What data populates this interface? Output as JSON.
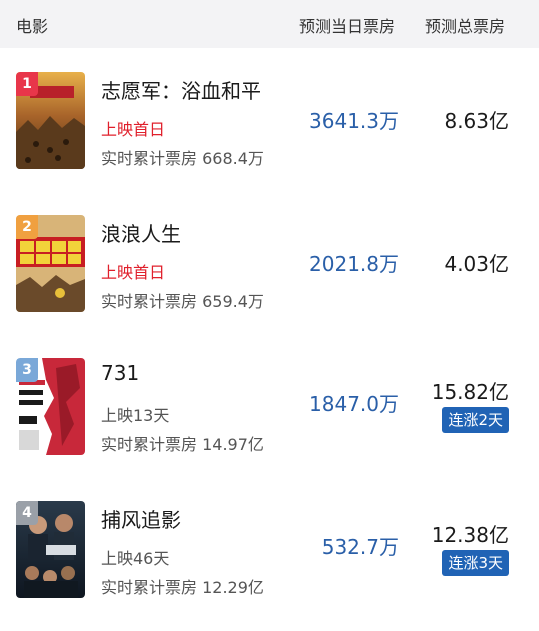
{
  "header": {
    "movie": "电影",
    "today_forecast": "预测当日票房",
    "total_forecast": "预测总票房"
  },
  "colors": {
    "status_red": "#e0202c",
    "status_gray": "#555555",
    "today_blue": "#2a5fa8",
    "badge_blue": "#2063b5",
    "rank_1": "#e8364a",
    "rank_2": "#f0a040",
    "rank_3": "#7aa8d8",
    "rank_4": "#9aa0a8"
  },
  "movies": [
    {
      "rank": "1",
      "title": "志愿军：浴血和平",
      "status": "上映首日",
      "cumulative": "实时累计票房 668.4万",
      "today": "3641.3万",
      "total": "8.63亿",
      "streak": ""
    },
    {
      "rank": "2",
      "title": "浪浪人生",
      "status": "上映首日",
      "cumulative": "实时累计票房 659.4万",
      "today": "2021.8万",
      "total": "4.03亿",
      "streak": ""
    },
    {
      "rank": "3",
      "title": "731",
      "status": "上映13天",
      "cumulative": "实时累计票房 14.97亿",
      "today": "1847.0万",
      "total": "15.82亿",
      "streak": "连涨2天"
    },
    {
      "rank": "4",
      "title": "捕风追影",
      "status": "上映46天",
      "cumulative": "实时累计票房 12.29亿",
      "today": "532.7万",
      "total": "12.38亿",
      "streak": "连涨3天"
    }
  ]
}
